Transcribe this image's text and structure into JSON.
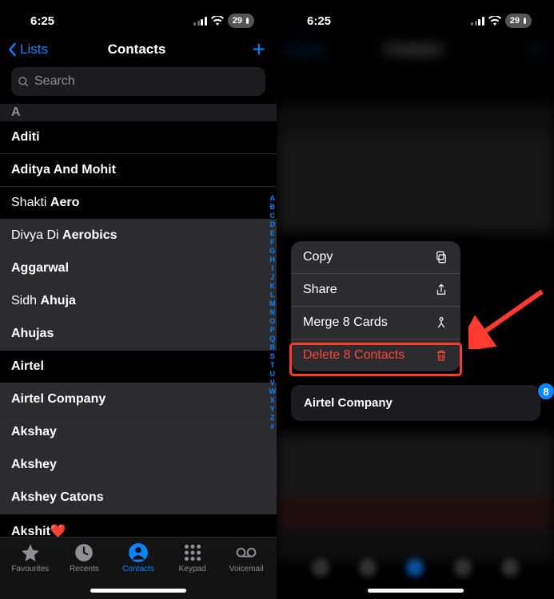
{
  "status": {
    "time": "6:25",
    "battery": "29"
  },
  "left": {
    "nav": {
      "back": "Lists",
      "title": "Contacts"
    },
    "search_placeholder": "Search",
    "section": "A",
    "contacts": [
      {
        "first": "",
        "last": "Aditi",
        "sel": false
      },
      {
        "first": "",
        "last": "Aditya And Mohit",
        "sel": false
      },
      {
        "first": "Shakti ",
        "last": "Aero",
        "sel": false
      },
      {
        "first": "Divya Di ",
        "last": "Aerobics",
        "sel": true
      },
      {
        "first": "",
        "last": "Aggarwal",
        "sel": true
      },
      {
        "first": "Sidh ",
        "last": "Ahuja",
        "sel": true
      },
      {
        "first": "",
        "last": "Ahujas",
        "sel": true
      },
      {
        "first": "",
        "last": "Airtel",
        "sel": false
      },
      {
        "first": "",
        "last": "Airtel Company",
        "sel": true
      },
      {
        "first": "",
        "last": "Akshay",
        "sel": true
      },
      {
        "first": "",
        "last": "Akshey",
        "sel": true
      },
      {
        "first": "",
        "last": "Akshey Catons",
        "sel": true
      },
      {
        "first": "",
        "last": "Akshit❤️",
        "sel": false
      }
    ],
    "index": [
      "A",
      "B",
      "C",
      "D",
      "E",
      "F",
      "G",
      "H",
      "I",
      "J",
      "K",
      "L",
      "M",
      "N",
      "O",
      "P",
      "Q",
      "R",
      "S",
      "T",
      "U",
      "V",
      "W",
      "X",
      "Y",
      "Z",
      "#"
    ],
    "tabs": {
      "favourites": "Favourites",
      "recents": "Recents",
      "contacts": "Contacts",
      "keypad": "Keypad",
      "voicemail": "Voicemail"
    }
  },
  "right": {
    "menu": {
      "copy": "Copy",
      "share": "Share",
      "merge": "Merge 8 Cards",
      "delete": "Delete 8 Contacts"
    },
    "preview_label": "Airtel Company",
    "badge": "8"
  }
}
